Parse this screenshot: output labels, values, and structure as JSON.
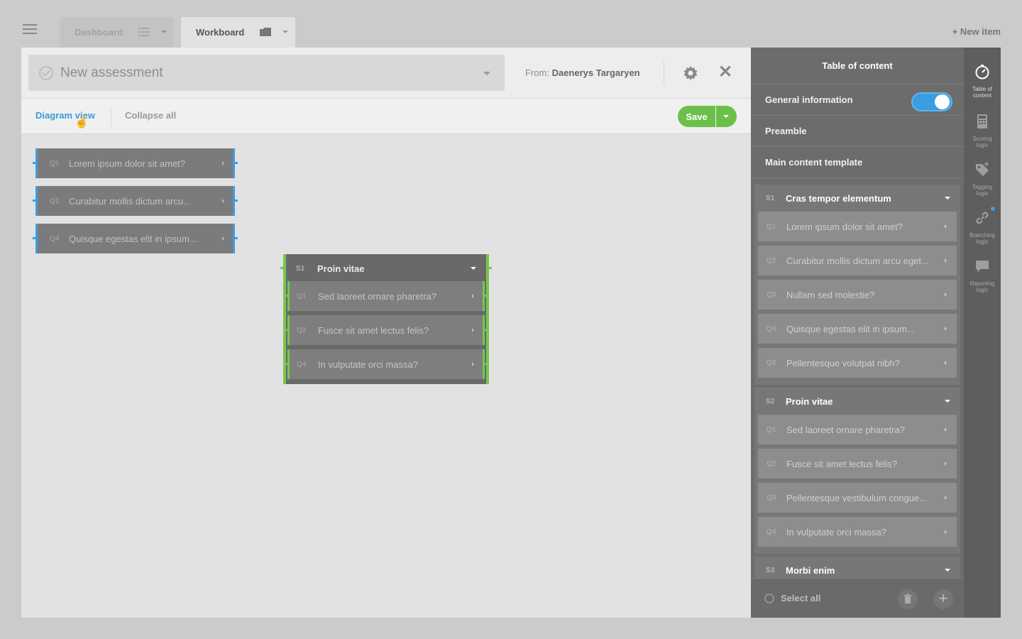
{
  "tabs": [
    {
      "label": "Dashboard"
    },
    {
      "label": "Workboard"
    }
  ],
  "new_item": "+ New item",
  "assessment": {
    "title": "New assessment",
    "from_label": "From:",
    "from_name": "Daenerys Targaryen"
  },
  "toolbar": {
    "diagram_view": "Diagram view",
    "collapse_all": "Collapse all",
    "save": "Save"
  },
  "diagram": {
    "loose_questions": [
      {
        "num": "Q1",
        "text": "Lorem ipsum dolor sit amet?"
      },
      {
        "num": "Q2",
        "text": "Curabitur mollis dictum arcu..."
      },
      {
        "num": "Q4",
        "text": "Quisque egestas elit in ipsum..."
      }
    ],
    "section": {
      "num": "S1",
      "title": "Proin vitae",
      "questions": [
        {
          "num": "Q1",
          "text": "Sed laoreet ornare pharetra?"
        },
        {
          "num": "Q2",
          "text": "Fusce sit amet lectus felis?"
        },
        {
          "num": "Q4",
          "text": "In vulputate orci massa?"
        }
      ]
    }
  },
  "toc": {
    "title": "Table of content",
    "general_information": "General information",
    "general_information_enabled": true,
    "preamble": "Preamble",
    "main_content_template": "Main content template",
    "sections": [
      {
        "num": "S1",
        "title": "Cras tempor elementum",
        "questions": [
          {
            "num": "Q1",
            "text": "Lorem ipsum dolor sit amet?"
          },
          {
            "num": "Q2",
            "text": "Curabitur mollis dictum arcu eget..."
          },
          {
            "num": "Q3",
            "text": "Nullam sed molestie?"
          },
          {
            "num": "Q4",
            "text": "Quisque egestas elit in ipsum..."
          },
          {
            "num": "Q5",
            "text": "Pellentesque volutpat nibh?"
          }
        ]
      },
      {
        "num": "S2",
        "title": "Proin vitae",
        "questions": [
          {
            "num": "Q1",
            "text": "Sed laoreet ornare pharetra?"
          },
          {
            "num": "Q2",
            "text": "Fusce sit amet lectus felis?"
          },
          {
            "num": "Q3",
            "text": "Pellentesque vestibulum congue..."
          },
          {
            "num": "Q4",
            "text": "In vulputate orci massa?"
          }
        ]
      },
      {
        "num": "S3",
        "title": "Morbi enim",
        "questions": []
      }
    ],
    "select_all": "Select all"
  },
  "rail": [
    {
      "label1": "Table of",
      "label2": "content",
      "icon": "compass-icon"
    },
    {
      "label1": "Scoring",
      "label2": "logic",
      "icon": "calculator-icon"
    },
    {
      "label1": "Tagging",
      "label2": "logic",
      "icon": "tag-icon"
    },
    {
      "label1": "Branching",
      "label2": "logic",
      "icon": "link-icon"
    },
    {
      "label1": "Reporting",
      "label2": "logic",
      "icon": "chat-icon"
    }
  ],
  "colors": {
    "accent_blue": "#3b9ee0",
    "accent_green": "#6cc04a"
  }
}
